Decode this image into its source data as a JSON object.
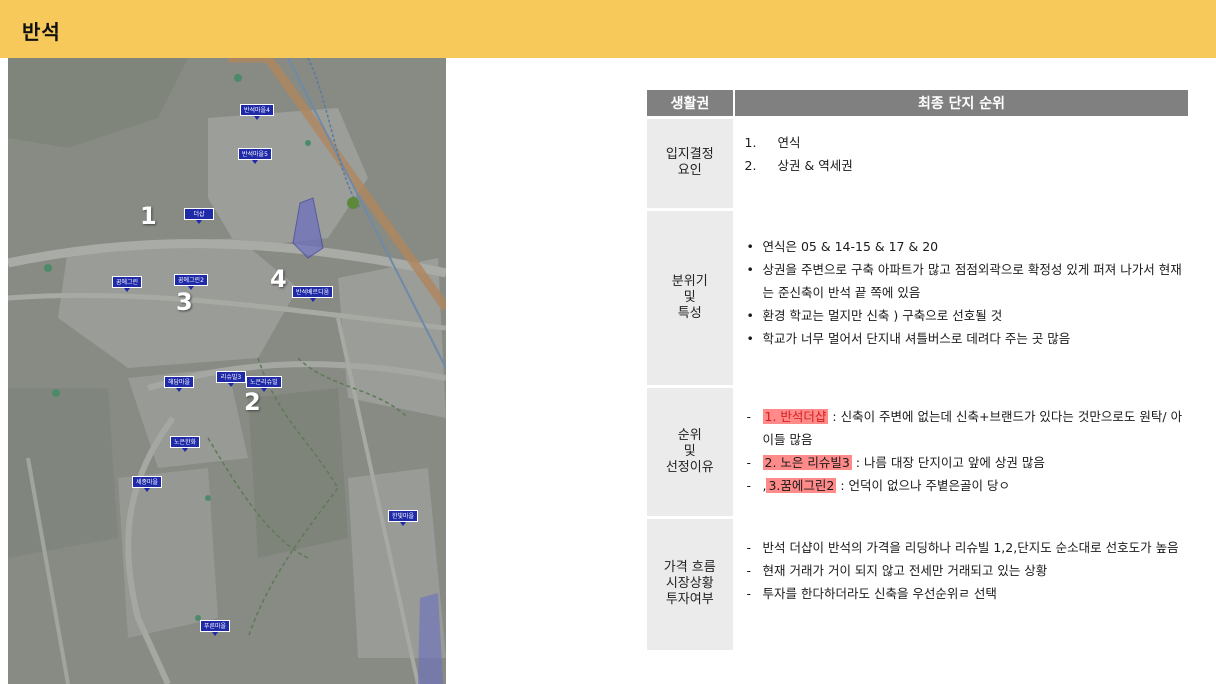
{
  "header": {
    "title": "반석"
  },
  "map": {
    "numbers": [
      "1",
      "2",
      "3",
      "4"
    ],
    "pins": [
      "더샵",
      "반석마을4",
      "반석마을5",
      "꿈에그린",
      "꿈에그린2",
      "리슈빌3",
      "노은리슈빌",
      "세종마을",
      "해담마을",
      "노은한화",
      "한빛마을",
      "반석베르디움",
      "푸른마을"
    ]
  },
  "table": {
    "headers": [
      "생활권",
      "최종 단지 순위"
    ],
    "rows": [
      {
        "label": "입지결정\n요인",
        "items": [
          {
            "n": "1.",
            "text": "연식"
          },
          {
            "n": "2.",
            "text": "상권 & 역세권"
          }
        ]
      },
      {
        "label": "분위기\n및\n특성",
        "items": [
          "연식은 05 & 14-15 & 17 & 20",
          "상권을 주변으로 구축 아파트가 많고 점점외곽으로 확정성 있게 퍼져 나가서 현재는 준신축이 반석 끝 쪽에 있음",
          "환경 학교는 멀지만 신축 ) 구축으로 선호될 것",
          "학교가 너무 멀어서 단지내 셔틀버스로 데려다 주는 곳 많음"
        ]
      },
      {
        "label": "순위\n및\n선정이유",
        "items": [
          {
            "prefix": "",
            "hl": "1. 반석더샵",
            "text": " : 신축이 주변에 없는데 신축+브랜드가 있다는 것만으로도 원탁/ 아이들 많음"
          },
          {
            "prefix": "",
            "hl": "2. 노은 리슈빌3",
            "text": " : 나름 대장 단지이고 앞에 상권 많음"
          },
          {
            "prefix": ",",
            "hl": "3.꿈에그린2",
            "text": " :  언덕이 없으나 주볕은골이 당ㅇ"
          }
        ]
      },
      {
        "label": "가격 흐름\n시장상황\n투자여부",
        "items": [
          "반석 더샵이 반석의 가격을 리딩하나 리슈빌 1,2,단지도 순소대로 선호도가 높음",
          "현재 거래가 거이 되지 않고 전세만 거래되고 있는 상황",
          "투자를 한다하더라도 신축을 우선순위ㄹ 선택"
        ]
      }
    ]
  }
}
